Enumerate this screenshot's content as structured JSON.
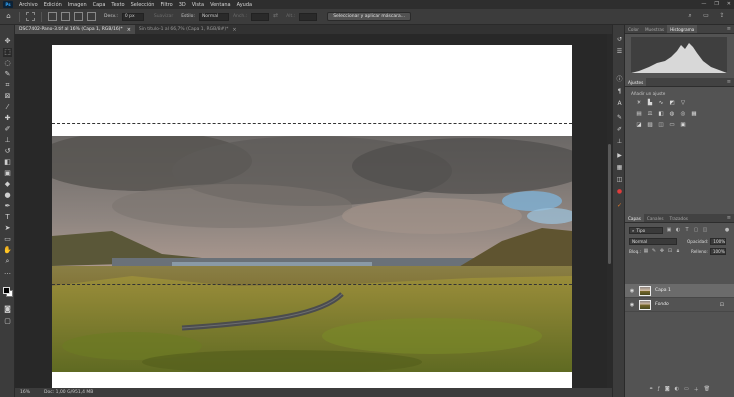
{
  "menu": [
    "Archivo",
    "Edición",
    "Imagen",
    "Capa",
    "Texto",
    "Selección",
    "Filtro",
    "3D",
    "Vista",
    "Ventana",
    "Ayuda"
  ],
  "app_badge": "Ps",
  "window_controls": [
    "minimize-icon",
    "maximize-icon",
    "close-icon"
  ],
  "options": {
    "feather_label": "Desv.:",
    "feather_value": "0 px",
    "smooth_label": "Suavizar",
    "style_label": "Estilo:",
    "style_value": "Normal",
    "width_label": "Anch.:",
    "height_label": "Alt.:",
    "select_mask_button": "Seleccionar y aplicar máscara..."
  },
  "tabs": [
    {
      "label": "DSC7402-Pano-3.tif al 16% (Capa 1, RGB/16)*",
      "active": true
    },
    {
      "label": "Sin título-1 al 66,7% (Capa 1, RGB/8#)*",
      "active": false
    }
  ],
  "status": {
    "zoom": "16%",
    "doc": "Doc: 1,00 G/951,4 MB"
  },
  "panels": {
    "histogram_tabs": [
      "Color",
      "Muestras",
      "Histograma"
    ],
    "histogram_active": "Histograma",
    "adjust_tab": "Ajustes",
    "adjust_hint": "Añadir un ajuste",
    "layers_tabs": [
      "Capas",
      "Canales",
      "Trazados"
    ],
    "layers_active": "Capas",
    "filter_kind": "Tipo",
    "blend_mode": "Normal",
    "opacity_label": "Opacidad:",
    "opacity_value": "100%",
    "lock_label": "Bloq.:",
    "fill_label": "Relleno:",
    "fill_value": "100%",
    "layers": [
      {
        "name": "Capa 1",
        "selected": true
      },
      {
        "name": "Fondo",
        "selected": false
      }
    ]
  },
  "colors": {
    "menubar": "#2e2e2e",
    "panel_bg": "#535353",
    "canvas_bg": "#282828",
    "accent_red": "#e03c3c"
  }
}
